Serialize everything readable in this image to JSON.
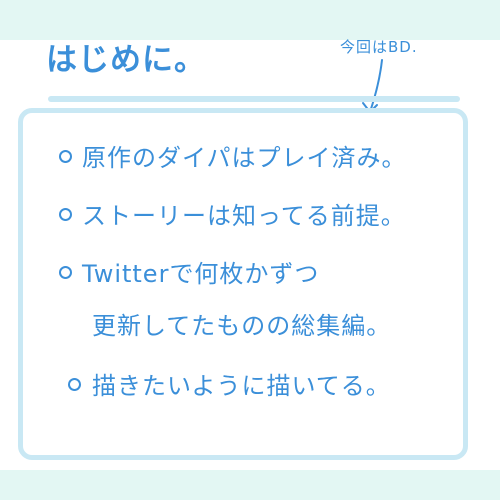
{
  "title": "はじめに。",
  "note": "今回はBD.",
  "items": [
    {
      "lines": [
        "原作のダイパはプレイ済み。"
      ]
    },
    {
      "lines": [
        "ストーリーは知ってる前提。"
      ]
    },
    {
      "lines": [
        "Twitterで何枚かずつ",
        "更新してたものの総集編。"
      ]
    },
    {
      "lines": [
        "描きたいように描いてる。"
      ]
    }
  ],
  "colors": {
    "text": "#3b8fd9",
    "band": "#e3f7f3",
    "panel_border": "#c9e8f4"
  }
}
